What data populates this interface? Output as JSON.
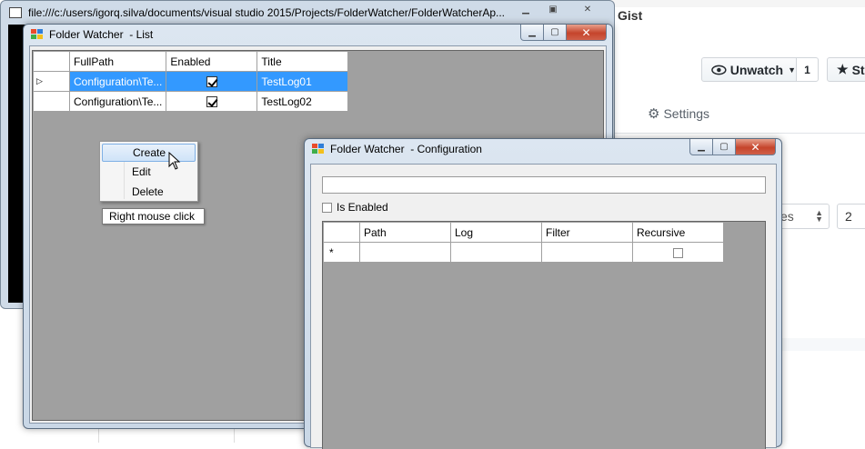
{
  "browser": {
    "gist_label": "Gist",
    "unwatch_label": "Unwatch",
    "watch_count": "1",
    "star_label": "St",
    "tab_partial": "s",
    "settings_label": "Settings",
    "select1_value": "es",
    "select2_value": "2"
  },
  "console": {
    "title": "file:///c:/users/igorq.silva/documents/visual studio 2015/Projects/FolderWatcher/FolderWatcherAp..."
  },
  "list_window": {
    "title": "Folder Watcher  - List",
    "columns": [
      "FullPath",
      "Enabled",
      "Title"
    ],
    "rows": [
      {
        "fullpath": "Configuration\\Te...",
        "enabled": true,
        "title": "TestLog01",
        "selected": true
      },
      {
        "fullpath": "Configuration\\Te...",
        "enabled": true,
        "title": "TestLog02",
        "selected": false
      }
    ]
  },
  "context_menu": {
    "items": [
      "Create",
      "Edit",
      "Delete"
    ],
    "highlighted": "Create"
  },
  "tooltip": {
    "text": "Right mouse click"
  },
  "config_window": {
    "title": "Folder Watcher  - Configuration",
    "name_value": "",
    "is_enabled_label": "Is Enabled",
    "is_enabled_checked": false,
    "columns": [
      "Path",
      "Log",
      "Filter",
      "Recursive"
    ],
    "new_row_marker": "*"
  },
  "colors": {
    "selection": "#3399ff",
    "grid_background": "#a0a0a0",
    "close_button": "#c5452c"
  }
}
